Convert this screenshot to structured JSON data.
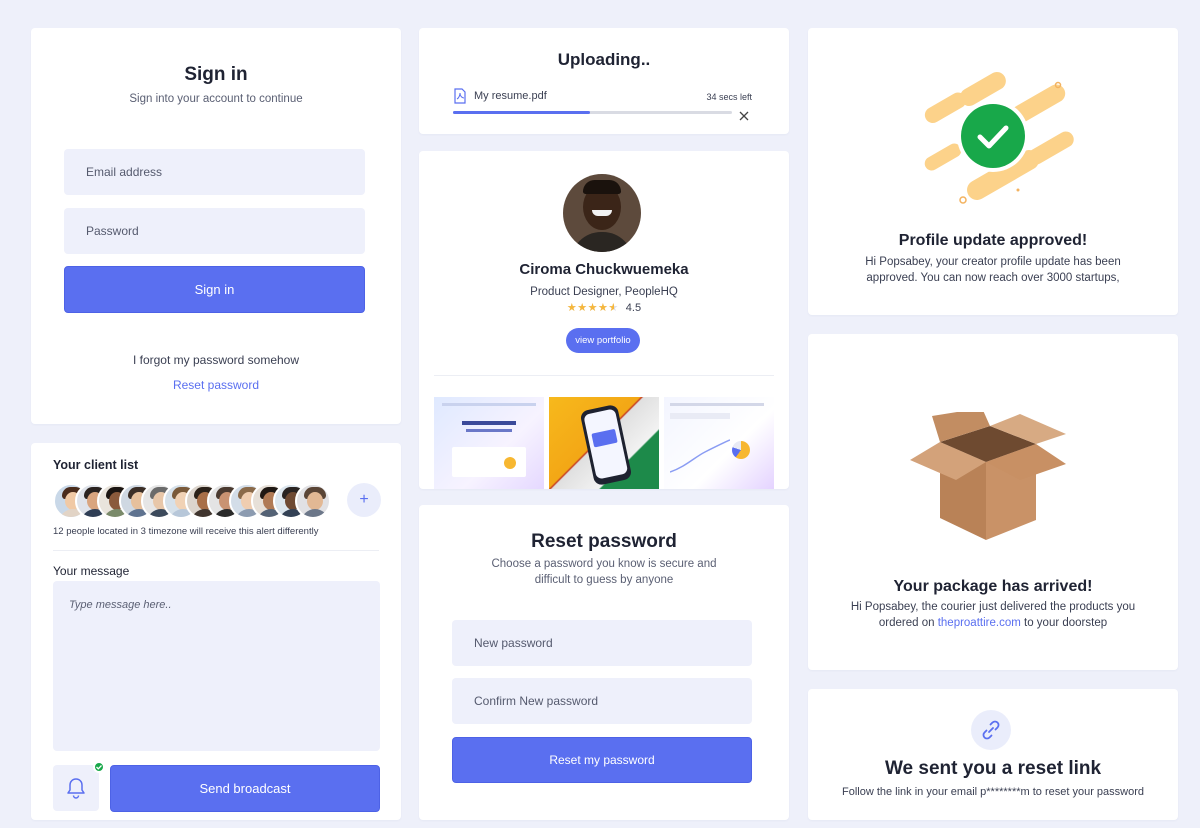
{
  "signin": {
    "title": "Sign in",
    "subtitle": "Sign into your account to continue",
    "email_placeholder": "Email address",
    "password_placeholder": "Password",
    "button": "Sign in",
    "forgot_text": "I forgot my password somehow",
    "reset_link": "Reset password"
  },
  "upload": {
    "title": "Uploading..",
    "file_name": "My resume.pdf",
    "time_left": "34 secs left",
    "progress": 0.49
  },
  "profile": {
    "name": "Ciroma Chuckwuemeka",
    "role": "Product Designer, PeopleHQ",
    "rating": "4.5",
    "rating_value": 4.5,
    "stars": "★★★★★",
    "button": "view portfolio"
  },
  "approved": {
    "title": "Profile update approved!",
    "message": "Hi Popsabey, your creator profile update has been approved. You can now reach over 3000 startups,"
  },
  "clients": {
    "title": "Your client list",
    "note": "12 people located in 3  timezone will receive this alert differently",
    "message_label": "Your message",
    "message_placeholder": "Type message here..",
    "button": "Send broadcast",
    "add_symbol": "+"
  },
  "reset": {
    "title": "Reset password",
    "subtitle": "Choose a password you know is secure and difficult to guess by anyone",
    "new_placeholder": "New password",
    "confirm_placeholder": "Confirm New password",
    "button": "Reset my password"
  },
  "package": {
    "title": "Your package has arrived!",
    "line1": "Hi Popsabey, the courier just delivered the products you",
    "line2_prefix": "ordered on ",
    "line2_link": "theproattire.com",
    "line2_suffix": " to your doorstep"
  },
  "resetlink": {
    "title": "We sent you a reset link",
    "message": "Follow the link in your email p********m to reset your password"
  },
  "colors": {
    "background": "#eef0fa",
    "accent": "#5a6ff0",
    "success": "#18a84a",
    "badge_yellow": "#fcd28a",
    "star": "#f6b73c"
  },
  "icons": {
    "file": "pdf-file-icon",
    "close": "close-icon",
    "check": "check-icon",
    "bell": "bell-icon",
    "link": "link-icon",
    "box": "open-box-icon"
  }
}
